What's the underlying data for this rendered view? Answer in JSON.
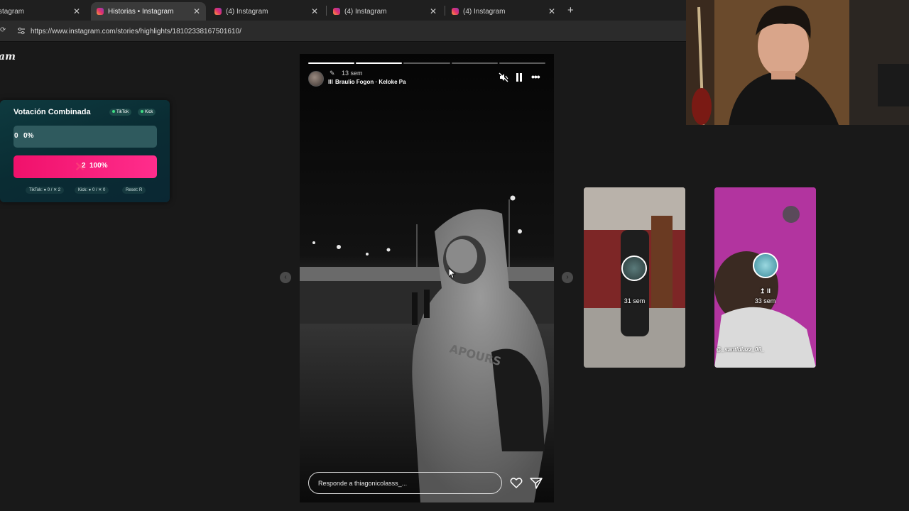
{
  "tabs": [
    {
      "title": "stagram",
      "active": false
    },
    {
      "title": "Historias • Instagram",
      "active": true
    },
    {
      "title": "(4) Instagram",
      "active": false
    },
    {
      "title": "(4) Instagram",
      "active": false
    },
    {
      "title": "(4) Instagram",
      "active": false
    }
  ],
  "address": {
    "url": "https://www.instagram.com/stories/highlights/18102338167501610/"
  },
  "logo_fragment": "am",
  "vote": {
    "title": "Votación Combinada",
    "badges": [
      "TikTok",
      "Kick"
    ],
    "option1": {
      "label": "0",
      "percent_text": "0%",
      "fraction": 0
    },
    "option2": {
      "label": "2",
      "percent_text": "100%",
      "fraction": 1
    },
    "footer": {
      "tiktok": "TikTok: ● 0 / ✕ 2",
      "kick": "Kick: ● 0 / ✕ 0",
      "reset": "Reset: R"
    }
  },
  "story": {
    "time": "13 sem",
    "song": "Braulio Fogon · Keloke Pa",
    "reply_placeholder": "Responde a thiagonicolasss_...",
    "progress_done": 2,
    "progress_total": 5
  },
  "cards": [
    {
      "time": "31 sem",
      "tag": "",
      "name": ""
    },
    {
      "time": "33 sem",
      "tag": "@_santidiazz_08_",
      "name": "↥ II"
    }
  ],
  "colors": {
    "accent_pink": "#f0116b",
    "vote_teal": "#0e3a3f",
    "instagram_gradient": [
      "#f9a23a",
      "#e1306c",
      "#8a3ab9"
    ]
  },
  "icons": [
    "reload-icon",
    "site-info-icon",
    "mute-icon",
    "pause-icon",
    "more-icon",
    "heart-icon",
    "send-icon",
    "chevron-left-icon",
    "chevron-right-icon",
    "close-icon",
    "plus-icon"
  ]
}
